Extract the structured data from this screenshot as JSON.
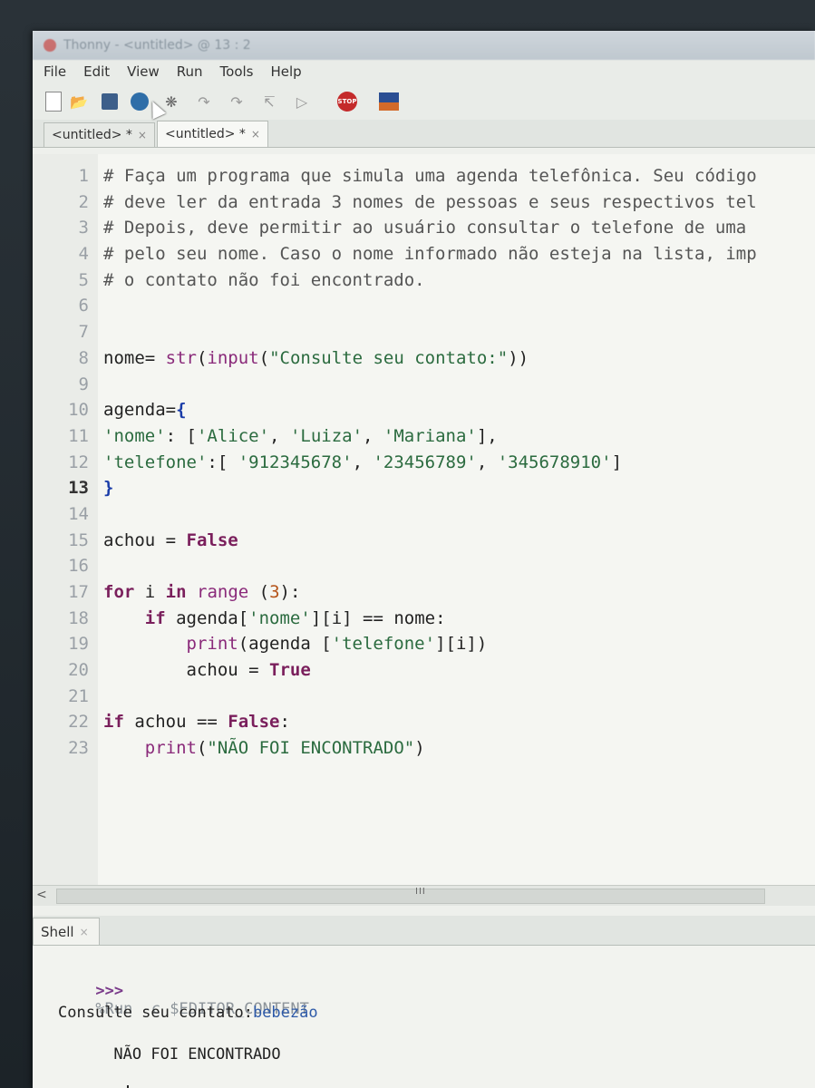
{
  "window": {
    "title": "Thonny - <untitled> @ 13 : 2"
  },
  "menu": [
    "File",
    "Edit",
    "View",
    "Run",
    "Tools",
    "Help"
  ],
  "toolbar": {
    "stop_label": "STOP"
  },
  "tabs": [
    {
      "label": "<untitled> *",
      "close": "×"
    },
    {
      "label": "<untitled> *",
      "close": "×"
    }
  ],
  "editor": {
    "line_numbers": [
      "1",
      "2",
      "3",
      "4",
      "5",
      "6",
      "7",
      "8",
      "9",
      "10",
      "11",
      "12",
      "13",
      "14",
      "15",
      "16",
      "17",
      "18",
      "19",
      "20",
      "21",
      "22",
      "23"
    ],
    "current_line": "13",
    "lines": [
      "# Faça um programa que simula uma agenda telefônica. Seu código",
      "# deve ler da entrada 3 nomes de pessoas e seus respectivos tel",
      "# Depois, deve permitir ao usuário consultar o telefone de uma",
      "# pelo seu nome. Caso o nome informado não esteja na lista, imp",
      "# o contato não foi encontrado.",
      "",
      "",
      "nome= str(input(\"Consulte seu contato:\"))",
      "",
      "agenda={",
      "'nome': ['Alice', 'Luiza', 'Mariana'],",
      "'telefone':[ '912345678', '23456789', '345678910']",
      "}",
      "",
      "achou = False",
      "",
      "for i in range (3):",
      "    if agenda['nome'][i] == nome:",
      "        print(agenda ['telefone'][i])",
      "        achou = True",
      "",
      "if achou == False:",
      "    print(\"NÃO FOI ENCONTRADO\")"
    ]
  },
  "scrollbar": {
    "left_arrow": "<",
    "grip": "III"
  },
  "shell": {
    "tab_label": "Shell",
    "tab_close": "×",
    "prompt": ">>>",
    "command": "%Run -c $EDITOR_CONTENT",
    "output_prompt_text": "Consulte seu contato:",
    "user_input": "bebezão",
    "result": "NÃO FOI ENCONTRADO"
  }
}
